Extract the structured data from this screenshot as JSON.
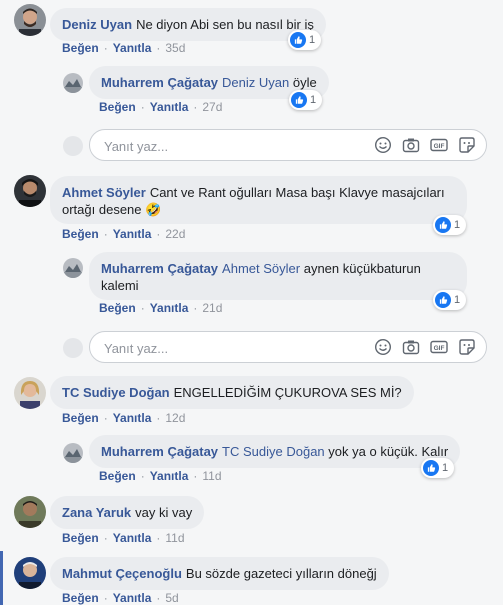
{
  "actions": {
    "like": "Beğen",
    "reply": "Yanıtla",
    "separator": "·"
  },
  "reply_box": {
    "placeholder": "Yanıt yaz...",
    "gif_label": "GIF"
  },
  "icons": [
    "emoji-icon",
    "camera-icon",
    "gif-icon",
    "sticker-icon",
    "like-reaction-icon"
  ],
  "colors": {
    "author": "#385898",
    "bubble": "#eaecef",
    "like_blue": "#1877f2",
    "background": "#f5f6f7"
  },
  "comments": [
    {
      "author": "Deniz Uyan",
      "text": "Ne diyon Abi sen bu nasıl bir iş",
      "time": "35d",
      "likes": "1",
      "replies": [
        {
          "author": "Muharrem Çağatay",
          "mention": "Deniz Uyan",
          "text": "öyle",
          "time": "27d",
          "likes": "1"
        }
      ]
    },
    {
      "author": "Ahmet Söyler",
      "text_line1": "Cant ve Rant oğulları Masa başı Klavye masajcıları",
      "text_line2": "ortağı desene",
      "emoji": "🤣",
      "time": "22d",
      "likes": "1",
      "replies": [
        {
          "author": "Muharrem Çağatay",
          "mention": "Ahmet Söyler",
          "text_line1": "aynen küçükbaturun",
          "text_line2": "kalemi",
          "time": "21d",
          "likes": "1"
        }
      ]
    },
    {
      "author": "TC Sudiye Doğan",
      "text": "ENGELLEDİĞİM ÇUKUROVA SES Mİ?",
      "time": "12d",
      "replies": [
        {
          "author": "Muharrem Çağatay",
          "mention": "TC Sudiye Doğan",
          "text": "yok ya o küçük. Kalır",
          "time": "11d",
          "likes": "1"
        }
      ]
    },
    {
      "author": "Zana Yaruk",
      "text": "vay ki vay",
      "time": "11d"
    },
    {
      "author": "Mahmut Çeçenoğlu",
      "text": "Bu sözde gazeteci yılların döneğj",
      "time": "5d"
    }
  ]
}
